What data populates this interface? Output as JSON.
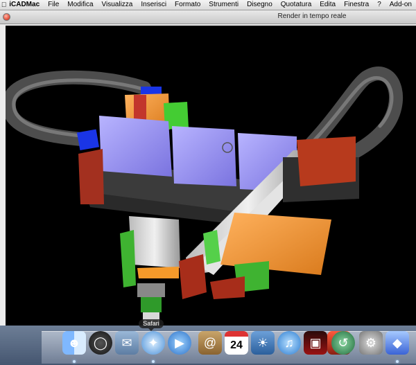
{
  "menubar": {
    "apple_icon": "apple-icon",
    "app_name": "iCADMac",
    "items": [
      "File",
      "Modifica",
      "Visualizza",
      "Inserisci",
      "Formato",
      "Strumenti",
      "Disegno",
      "Quotatura",
      "Edita",
      "Finestra",
      "?",
      "Add-on"
    ]
  },
  "window": {
    "title": "Render in tempo reale",
    "close_button_color": "#e1442e"
  },
  "viewport": {
    "background_color": "#000000",
    "content": "3D rendered mechanical assembly"
  },
  "dock": {
    "tooltip": "Safari",
    "items": [
      {
        "name": "finder",
        "icon": "finder-icon"
      },
      {
        "name": "dashboard",
        "icon": "dashboard-icon"
      },
      {
        "name": "mail",
        "icon": "mail-icon"
      },
      {
        "name": "safari",
        "icon": "compass-icon"
      },
      {
        "name": "ichat",
        "icon": "video-chat-icon"
      },
      {
        "name": "address-book",
        "icon": "address-book-icon"
      },
      {
        "name": "ical",
        "icon": "calendar-icon",
        "date": "24"
      },
      {
        "name": "iphoto",
        "icon": "photos-icon"
      },
      {
        "name": "itunes",
        "icon": "music-icon"
      },
      {
        "name": "front-row",
        "icon": "front-row-icon"
      },
      {
        "name": "photo-booth",
        "icon": "photo-booth-icon"
      },
      {
        "name": "time-machine",
        "icon": "time-machine-icon"
      },
      {
        "name": "system-preferences",
        "icon": "gear-icon"
      },
      {
        "name": "icadmac",
        "icon": "icadmac-icon"
      }
    ]
  }
}
